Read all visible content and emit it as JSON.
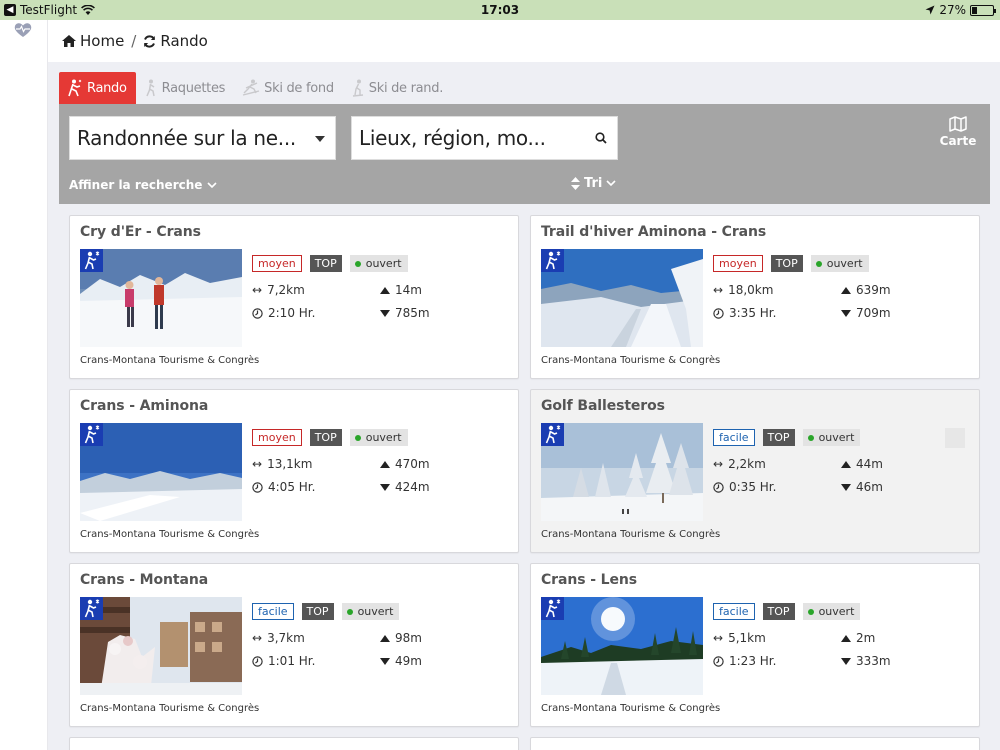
{
  "statusbar": {
    "back_app": "TestFlight",
    "time": "17:03",
    "battery": "27%",
    "battery_level": 0.27
  },
  "breadcrumb": {
    "home": "Home",
    "separator": "/",
    "current": "Rando"
  },
  "tabs": [
    {
      "label": "Rando",
      "active": true,
      "icon": "hiker-icon"
    },
    {
      "label": "Raquettes",
      "active": false,
      "icon": "snowshoe-icon"
    },
    {
      "label": "Ski de fond",
      "active": false,
      "icon": "cross-country-ski-icon"
    },
    {
      "label": "Ski de rand.",
      "active": false,
      "icon": "ski-touring-icon"
    }
  ],
  "search": {
    "category_value": "Randonnée sur la ne...",
    "location_placeholder": "Lieux, région, mo...",
    "map_label": "Carte",
    "refine_label": "Affiner la recherche",
    "sort_label": "Tri"
  },
  "colors": {
    "accent": "#e53935",
    "panel": "#a5a5a5",
    "badge_blue": "#1a3db2",
    "moyen": "#c62828",
    "facile": "#1e63b0",
    "open": "#2aa52a"
  },
  "cards": [
    {
      "title": "Cry d'Er - Crans",
      "difficulty": "moyen",
      "top": "TOP",
      "status": "ouvert",
      "distance": "7,2km",
      "duration": "2:10 Hr.",
      "ascent": "14m",
      "descent": "785m",
      "organization": "Crans-Montana Tourisme & Congrès"
    },
    {
      "title": "Trail d'hiver Aminona - Crans",
      "difficulty": "moyen",
      "top": "TOP",
      "status": "ouvert",
      "distance": "18,0km",
      "duration": "3:35 Hr.",
      "ascent": "639m",
      "descent": "709m",
      "organization": "Crans-Montana Tourisme & Congrès"
    },
    {
      "title": "Crans - Aminona",
      "difficulty": "moyen",
      "top": "TOP",
      "status": "ouvert",
      "distance": "13,1km",
      "duration": "4:05 Hr.",
      "ascent": "470m",
      "descent": "424m",
      "organization": "Crans-Montana Tourisme & Congrès"
    },
    {
      "title": "Golf Ballesteros",
      "difficulty": "facile",
      "top": "TOP",
      "status": "ouvert",
      "distance": "2,2km",
      "duration": "0:35 Hr.",
      "ascent": "44m",
      "descent": "46m",
      "organization": "Crans-Montana Tourisme & Congrès"
    },
    {
      "title": "Crans - Montana",
      "difficulty": "facile",
      "top": "TOP",
      "status": "ouvert",
      "distance": "3,7km",
      "duration": "1:01 Hr.",
      "ascent": "98m",
      "descent": "49m",
      "organization": "Crans-Montana Tourisme & Congrès"
    },
    {
      "title": "Crans - Lens",
      "difficulty": "facile",
      "top": "TOP",
      "status": "ouvert",
      "distance": "5,1km",
      "duration": "1:23 Hr.",
      "ascent": "2m",
      "descent": "333m",
      "organization": "Crans-Montana Tourisme & Congrès"
    }
  ]
}
